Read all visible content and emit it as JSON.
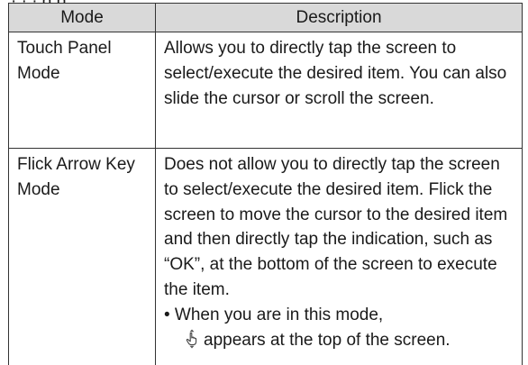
{
  "page": {
    "top_fragment": "· ·  · g   p"
  },
  "table": {
    "headers": {
      "mode": "Mode",
      "description": "Description"
    },
    "rows": [
      {
        "mode": "Touch Panel Mode",
        "description": "Allows you to directly tap the screen to select/execute the desired item. You can also slide the cursor or scroll the screen."
      },
      {
        "mode": "Flick Arrow Key Mode",
        "description": "Does not allow you to directly tap the screen to select/execute the desired item. Flick the screen to move the cursor to the desired item and then directly tap the indication, such as “OK”, at the bottom of the screen to execute the item.",
        "bullet_lead": "• When you are in this mode,",
        "bullet_rest": "appears at the top of the screen."
      }
    ]
  },
  "icons": {
    "flick_indicator": "hand-pointer-up-down-icon"
  }
}
